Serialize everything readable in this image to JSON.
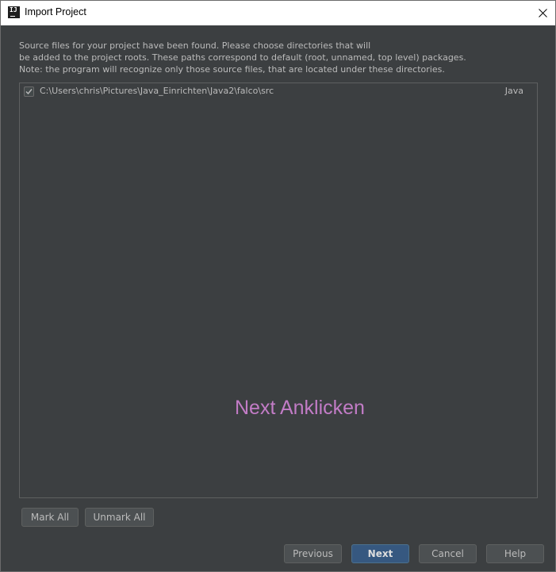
{
  "window": {
    "title": "Import Project",
    "app_icon_text": "IJ"
  },
  "description": {
    "line1": "Source files for your project have been found. Please choose directories that will",
    "line2": "be added to the project roots. These paths correspond to default (root, unnamed, top level) packages.",
    "line3": "Note: the program will recognize only those source files, that are located under these directories."
  },
  "roots": [
    {
      "checked": true,
      "path": "C:\\Users\\chris\\Pictures\\Java_Einrichten\\Java2\\falco\\src",
      "type": "Java"
    }
  ],
  "annotation": {
    "text": "Next Anklicken",
    "color": "#c27cc6"
  },
  "list_buttons": {
    "mark_all": "Mark All",
    "unmark_all": "Unmark All"
  },
  "footer_buttons": {
    "previous": "Previous",
    "next": "Next",
    "cancel": "Cancel",
    "help": "Help"
  },
  "colors": {
    "background": "#3c3f41",
    "primary_button": "#365880",
    "text": "#bbbbbb"
  }
}
